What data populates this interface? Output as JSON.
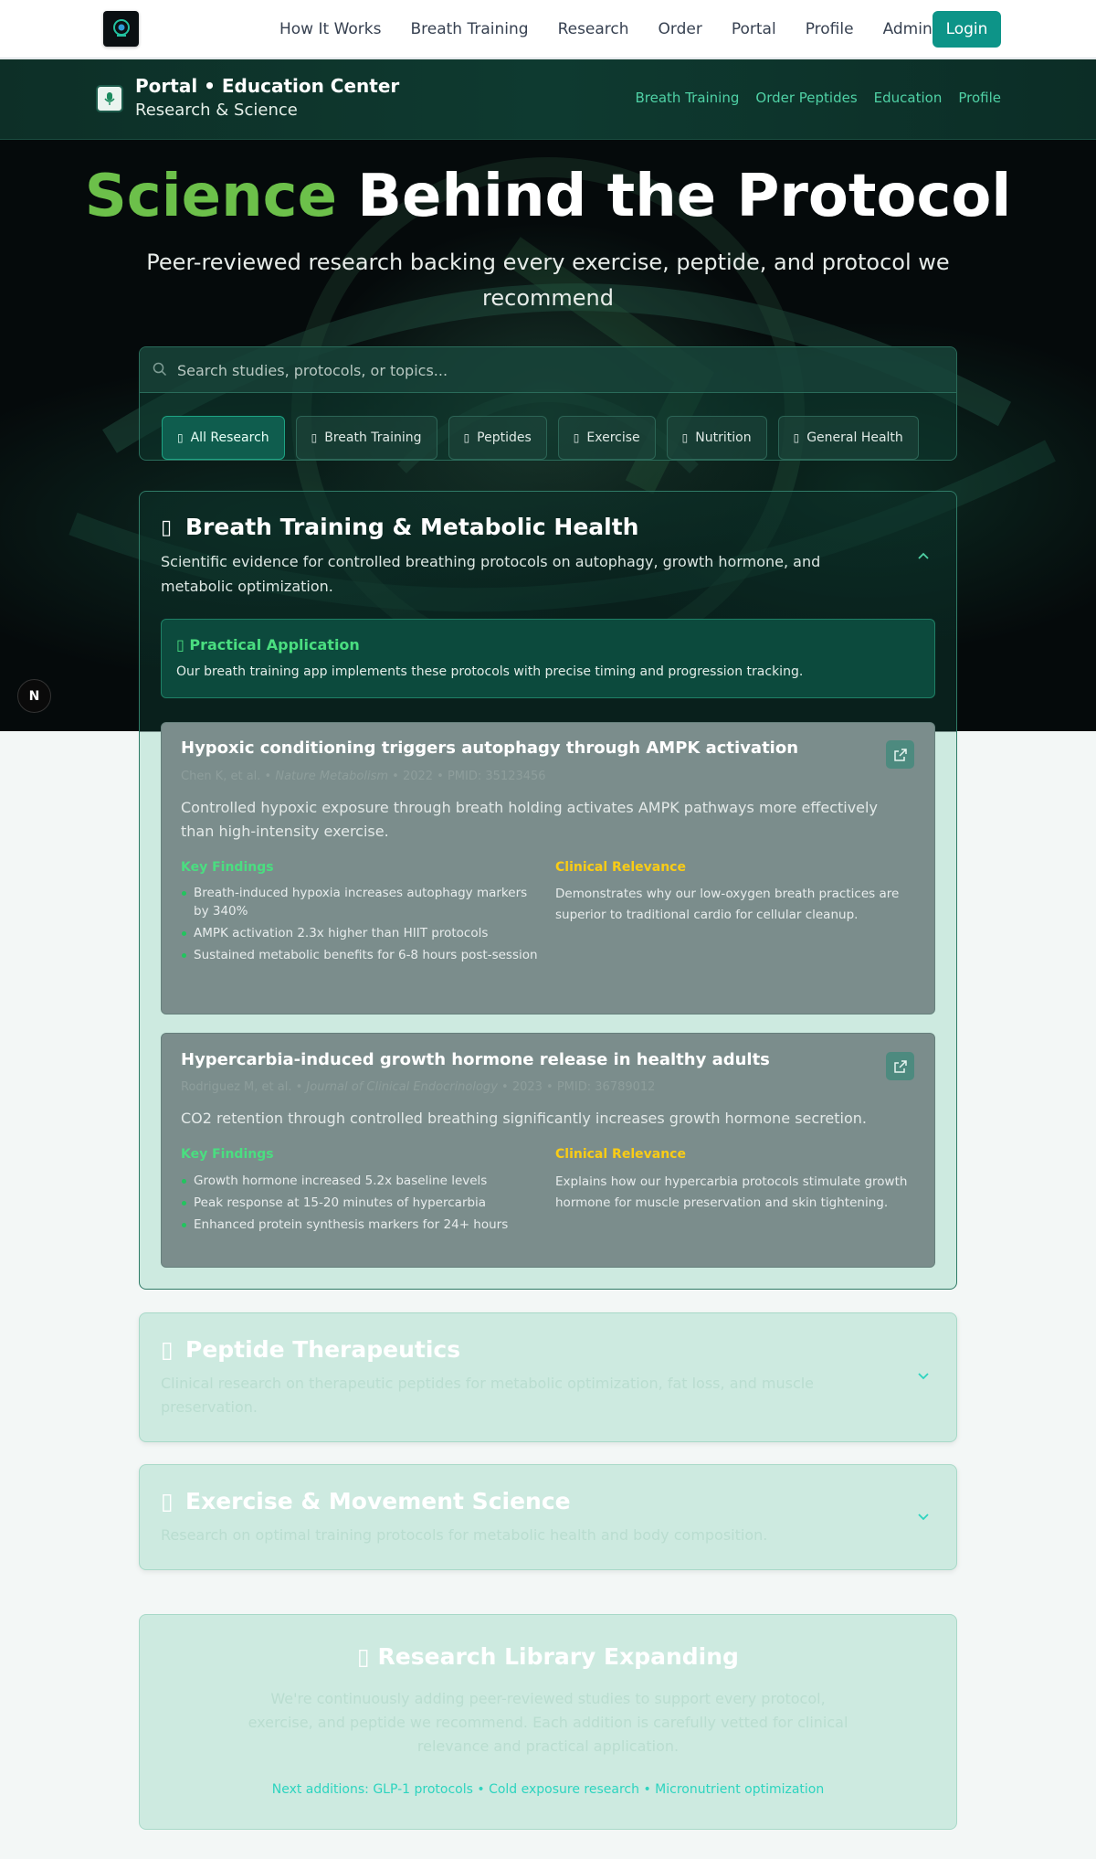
{
  "nav": {
    "links": [
      "How It Works",
      "Breath Training",
      "Research",
      "Order",
      "Portal",
      "Profile",
      "Admin"
    ],
    "login_label": "Login"
  },
  "subheader": {
    "title": "Portal • Education Center",
    "subtitle": "Research & Science",
    "links": [
      "Breath Training",
      "Order Peptides",
      "Education",
      "Profile"
    ]
  },
  "hero": {
    "title_highlight": "Science",
    "title_rest": "Behind the Protocol",
    "subtitle": "Peer-reviewed research backing every exercise, peptide, and protocol we recommend"
  },
  "search": {
    "placeholder": "Search studies, protocols, or topics...",
    "filters": [
      {
        "label": "All Research",
        "active": true
      },
      {
        "label": "Breath Training",
        "active": false
      },
      {
        "label": "Peptides",
        "active": false
      },
      {
        "label": "Exercise",
        "active": false
      },
      {
        "label": "Nutrition",
        "active": false
      },
      {
        "label": "General Health",
        "active": false
      }
    ]
  },
  "sections": [
    {
      "title": "Breath Training & Metabolic Health",
      "description": "Scientific evidence for controlled breathing protocols on autophagy, growth hormone, and metabolic optimization.",
      "expanded": true,
      "practical_title": "Practical Application",
      "practical_body": "Our breath training app implements these protocols with precise timing and progression tracking.",
      "studies": [
        {
          "title": "Hypoxic conditioning triggers autophagy through AMPK activation",
          "authors": "Chen K, et al.",
          "journal": "Nature Metabolism",
          "year_pmid": "2022 • PMID: 35123456",
          "summary": "Controlled hypoxic exposure through breath holding activates AMPK pathways more effectively than high-intensity exercise.",
          "key_findings_label": "Key Findings",
          "key_findings": [
            "Breath-induced hypoxia increases autophagy markers by 340%",
            "AMPK activation 2.3x higher than HIIT protocols",
            "Sustained metabolic benefits for 6-8 hours post-session"
          ],
          "clinical_label": "Clinical Relevance",
          "clinical": "Demonstrates why our low-oxygen breath practices are superior to traditional cardio for cellular cleanup."
        },
        {
          "title": "Hypercarbia-induced growth hormone release in healthy adults",
          "authors": "Rodriguez M, et al.",
          "journal": "Journal of Clinical Endocrinology",
          "year_pmid": "2023 • PMID: 36789012",
          "summary": "CO2 retention through controlled breathing significantly increases growth hormone secretion.",
          "key_findings_label": "Key Findings",
          "key_findings": [
            "Growth hormone increased 5.2x baseline levels",
            "Peak response at 15-20 minutes of hypercarbia",
            "Enhanced protein synthesis markers for 24+ hours"
          ],
          "clinical_label": "Clinical Relevance",
          "clinical": "Explains how our hypercarbia protocols stimulate growth hormone for muscle preservation and skin tightening."
        }
      ]
    },
    {
      "title": "Peptide Therapeutics",
      "description": "Clinical research on therapeutic peptides for metabolic optimization, fat loss, and muscle preservation.",
      "expanded": false
    },
    {
      "title": "Exercise & Movement Science",
      "description": "Research on optimal training protocols for metabolic health and body composition.",
      "expanded": false
    }
  ],
  "library": {
    "title": "Research Library Expanding",
    "body": "We're continuously adding peer-reviewed studies to support every protocol, exercise, and peptide we recommend. Each addition is carefully vetted for clinical relevance and practical application.",
    "next": "Next additions: GLP-1 protocols • Cold exposure research • Micronutrient optimization"
  },
  "badge": "N",
  "colors": {
    "accent": "#0d9488",
    "highlight_green": "#6cc04a",
    "findings_green": "#4ade80",
    "relevance_yellow": "#facc15"
  }
}
